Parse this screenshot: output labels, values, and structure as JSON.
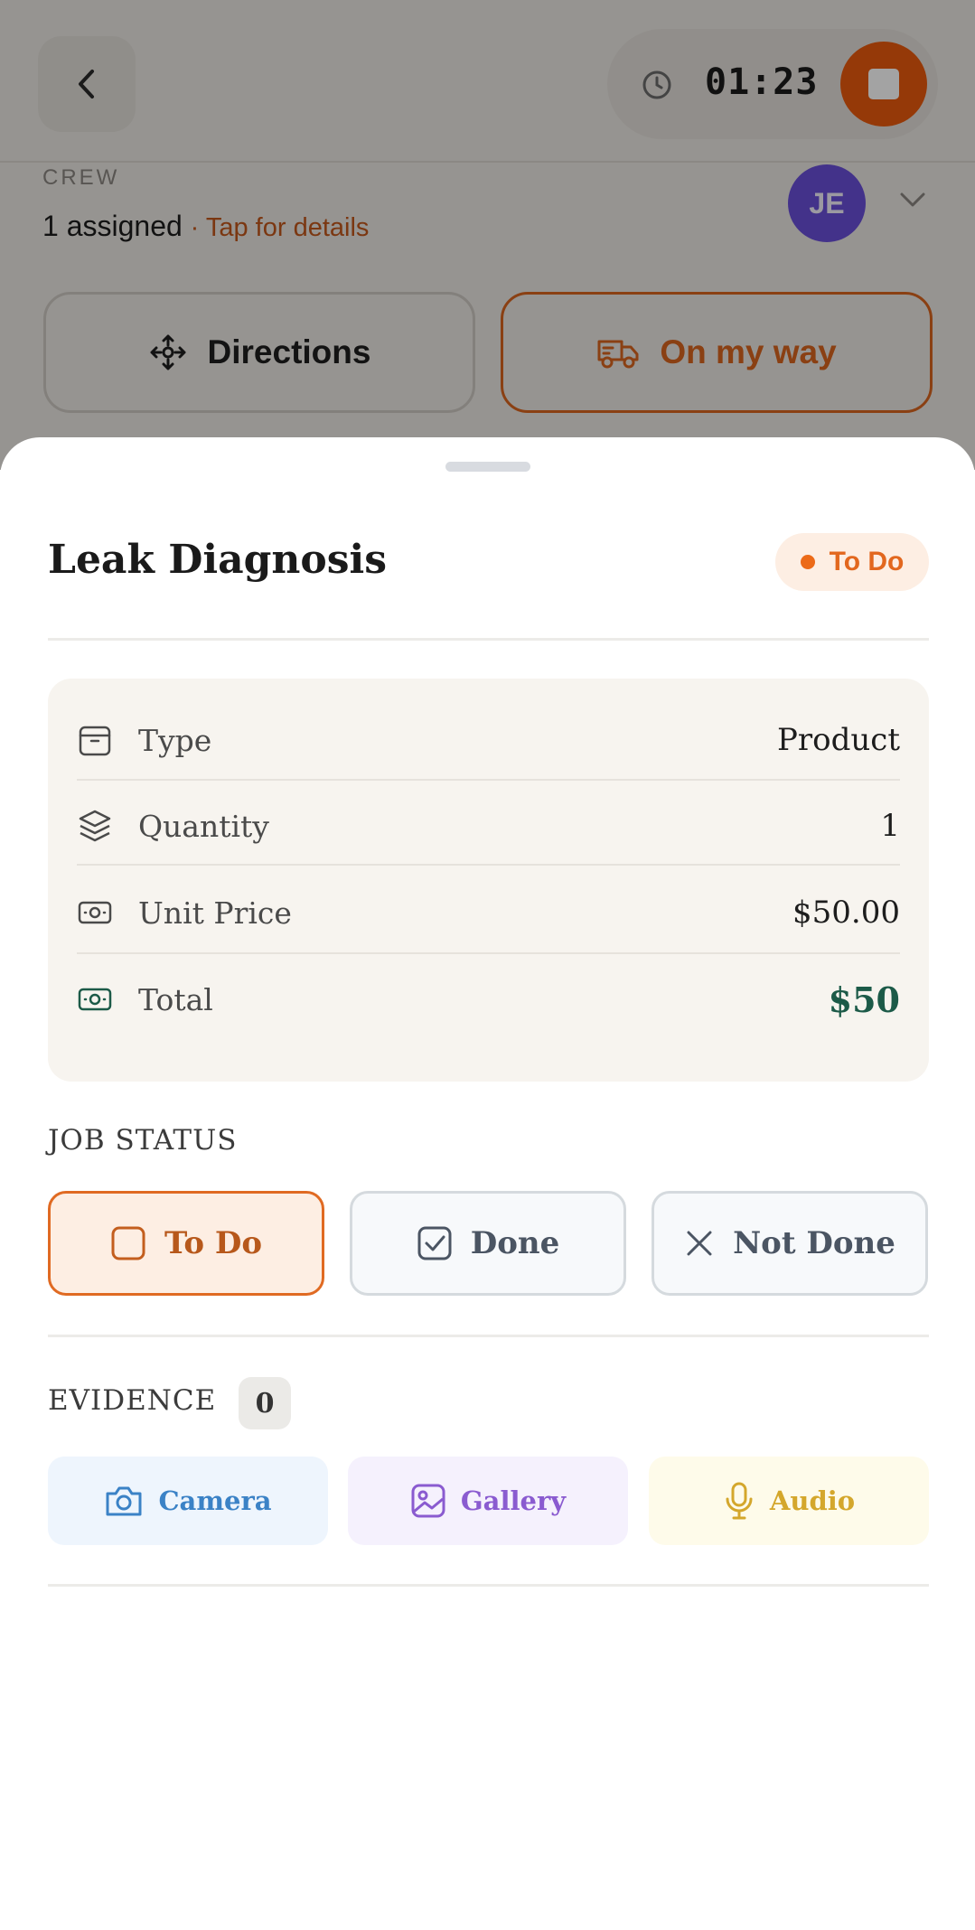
{
  "header": {
    "timer": "01:23"
  },
  "crew": {
    "label": "CREW",
    "assigned": "1 assigned",
    "tap_details": "· Tap for details",
    "avatar_initials": "JE"
  },
  "actions": {
    "directions": "Directions",
    "on_my_way": "On my way"
  },
  "sheet": {
    "title": "Leak Diagnosis",
    "status_badge": "To Do",
    "details": {
      "type_label": "Type",
      "type_value": "Product",
      "quantity_label": "Quantity",
      "quantity_value": "1",
      "unit_price_label": "Unit Price",
      "unit_price_value": "$50.00",
      "total_label": "Total",
      "total_value": "$50"
    },
    "job_status": {
      "label": "JOB STATUS",
      "options": [
        "To Do",
        "Done",
        "Not Done"
      ],
      "selected": "To Do"
    },
    "evidence": {
      "label": "EVIDENCE",
      "count": "0",
      "camera": "Camera",
      "gallery": "Gallery",
      "audio": "Audio"
    }
  },
  "colors": {
    "accent": "#ea5a0e",
    "total": "#1c5a48",
    "avatar": "#6a4fd8"
  }
}
